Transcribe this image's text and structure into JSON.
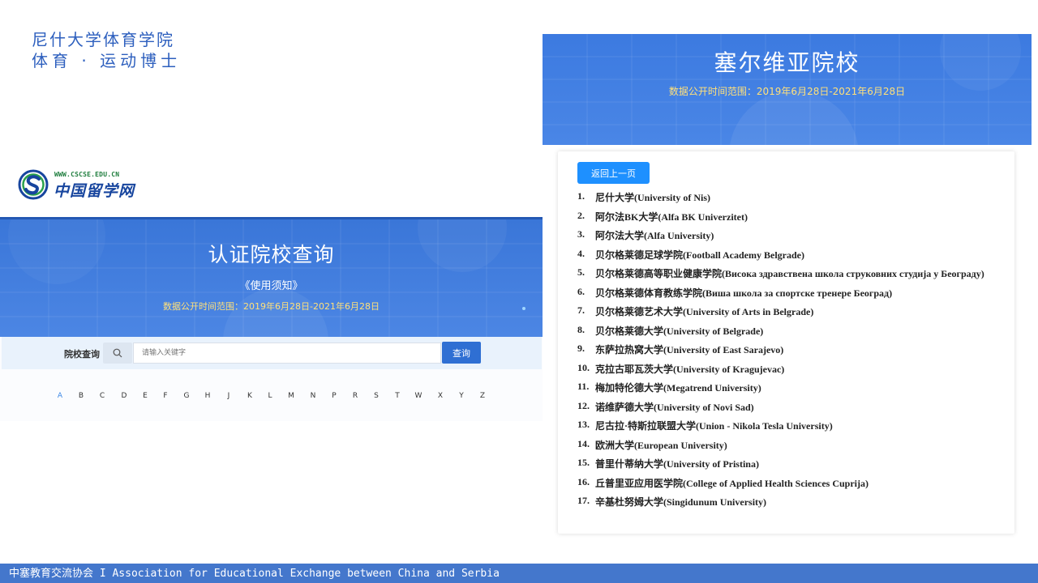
{
  "heading": {
    "line1": "尼什大学体育学院",
    "line2": "体育 · 运动博士"
  },
  "logo": {
    "url": "WWW.CSCSE.EDU.CN",
    "name": "中国留学网"
  },
  "search_page": {
    "title": "认证院校查询",
    "notice": "《使用须知》",
    "date_range": "数据公开时间范围：2019年6月28日-2021年6月28日",
    "search_label": "院校查询",
    "search_placeholder": "请输入关键字",
    "search_button": "查询",
    "letters": [
      "A",
      "B",
      "C",
      "D",
      "E",
      "F",
      "G",
      "H",
      "J",
      "K",
      "L",
      "M",
      "N",
      "P",
      "R",
      "S",
      "T",
      "W",
      "X",
      "Y",
      "Z"
    ],
    "active_letter": "A"
  },
  "serbia_page": {
    "title": "塞尔维亚院校",
    "date_range": "数据公开时间范围：2019年6月28日-2021年6月28日",
    "back_button": "返回上一页",
    "universities": [
      {
        "num": "1.",
        "name": "尼什大学(University of Nis)"
      },
      {
        "num": "2.",
        "name": "阿尔法BK大学(Alfa BK Univerzitet)"
      },
      {
        "num": "3.",
        "name": "阿尔法大学(Alfa University)"
      },
      {
        "num": "4.",
        "name": "贝尔格莱德足球学院(Football Academy Belgrade)"
      },
      {
        "num": "5.",
        "name": "贝尔格莱德高等职业健康学院(Висока здравствена школа струковних студија у Београду)"
      },
      {
        "num": "6.",
        "name": "贝尔格莱德体育教练学院(Виша школа за спортске тренере Београд)"
      },
      {
        "num": "7.",
        "name": "贝尔格莱德艺术大学(University of Arts in Belgrade)"
      },
      {
        "num": "8.",
        "name": "贝尔格莱德大学(University of Belgrade)"
      },
      {
        "num": "9.",
        "name": "东萨拉热窝大学(University of East Sarajevo)"
      },
      {
        "num": "10.",
        "name": "克拉古耶瓦茨大学(University of Kragujevac)"
      },
      {
        "num": "11.",
        "name": "梅加特伦德大学(Megatrend University)"
      },
      {
        "num": "12.",
        "name": "诺维萨德大学(University of Novi Sad)"
      },
      {
        "num": "13.",
        "name": "尼古拉·特斯拉联盟大学(Union - Nikola Tesla University)"
      },
      {
        "num": "14.",
        "name": "欧洲大学(European University)"
      },
      {
        "num": "15.",
        "name": "普里什蒂纳大学(University of Pristina)"
      },
      {
        "num": "16.",
        "name": "丘普里亚应用医学院(College of Applied Health Sciences Cuprija)"
      },
      {
        "num": "17.",
        "name": "辛基杜努姆大学(Singidunum University)"
      }
    ]
  },
  "footer": {
    "text": "中塞教育交流协会 I Association for Educational Exchange between China and Serbia"
  },
  "colors": {
    "banner_blue": "#3a76d8",
    "heading_blue": "#2d5fbe",
    "date_yellow": "#ffe07a",
    "button_blue": "#1e90ff",
    "footer_blue": "#4477cc"
  }
}
